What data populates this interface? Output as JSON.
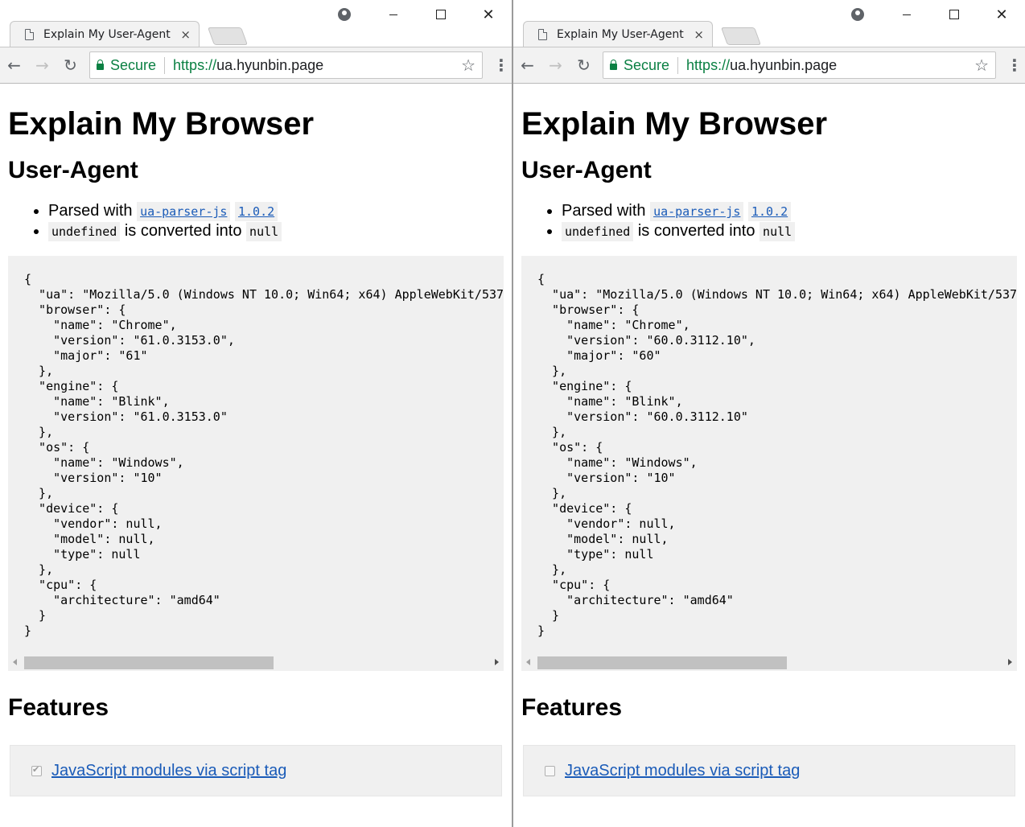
{
  "windows": [
    {
      "tab_title": "Explain My User-Agent",
      "tab_close": "×",
      "secure_label": "Secure",
      "url_scheme": "https://",
      "url_host": "ua.hyunbin.page",
      "page_title": "Explain My Browser",
      "ua_heading": "User-Agent",
      "parsed_with": "Parsed with",
      "parser_link": "ua-parser-js",
      "parser_version": "1.0.2",
      "undefined_code": "undefined",
      "converted_text": "is converted into",
      "null_code": "null",
      "json_output": "{\n  \"ua\": \"Mozilla/5.0 (Windows NT 10.0; Win64; x64) AppleWebKit/537.\n  \"browser\": {\n    \"name\": \"Chrome\",\n    \"version\": \"61.0.3153.0\",\n    \"major\": \"61\"\n  },\n  \"engine\": {\n    \"name\": \"Blink\",\n    \"version\": \"61.0.3153.0\"\n  },\n  \"os\": {\n    \"name\": \"Windows\",\n    \"version\": \"10\"\n  },\n  \"device\": {\n    \"vendor\": null,\n    \"model\": null,\n    \"type\": null\n  },\n  \"cpu\": {\n    \"architecture\": \"amd64\"\n  }\n}",
      "features_heading": "Features",
      "feature_label": "JavaScript modules via script tag",
      "feature_checked": true
    },
    {
      "tab_title": "Explain My User-Agent",
      "tab_close": "×",
      "secure_label": "Secure",
      "url_scheme": "https://",
      "url_host": "ua.hyunbin.page",
      "page_title": "Explain My Browser",
      "ua_heading": "User-Agent",
      "parsed_with": "Parsed with",
      "parser_link": "ua-parser-js",
      "parser_version": "1.0.2",
      "undefined_code": "undefined",
      "converted_text": "is converted into",
      "null_code": "null",
      "json_output": "{\n  \"ua\": \"Mozilla/5.0 (Windows NT 10.0; Win64; x64) AppleWebKit/537.\n  \"browser\": {\n    \"name\": \"Chrome\",\n    \"version\": \"60.0.3112.10\",\n    \"major\": \"60\"\n  },\n  \"engine\": {\n    \"name\": \"Blink\",\n    \"version\": \"60.0.3112.10\"\n  },\n  \"os\": {\n    \"name\": \"Windows\",\n    \"version\": \"10\"\n  },\n  \"device\": {\n    \"vendor\": null,\n    \"model\": null,\n    \"type\": null\n  },\n  \"cpu\": {\n    \"architecture\": \"amd64\"\n  }\n}",
      "features_heading": "Features",
      "feature_label": "JavaScript modules via script tag",
      "feature_checked": false
    }
  ],
  "icons": {
    "back": "←",
    "forward": "→",
    "reload": "↻",
    "star": "☆",
    "menu": "⋮",
    "close_window": "✕"
  },
  "colors": {
    "secure_green": "#0b8043",
    "link_blue": "#1a5bb8",
    "code_bg": "#f0f0f0"
  }
}
